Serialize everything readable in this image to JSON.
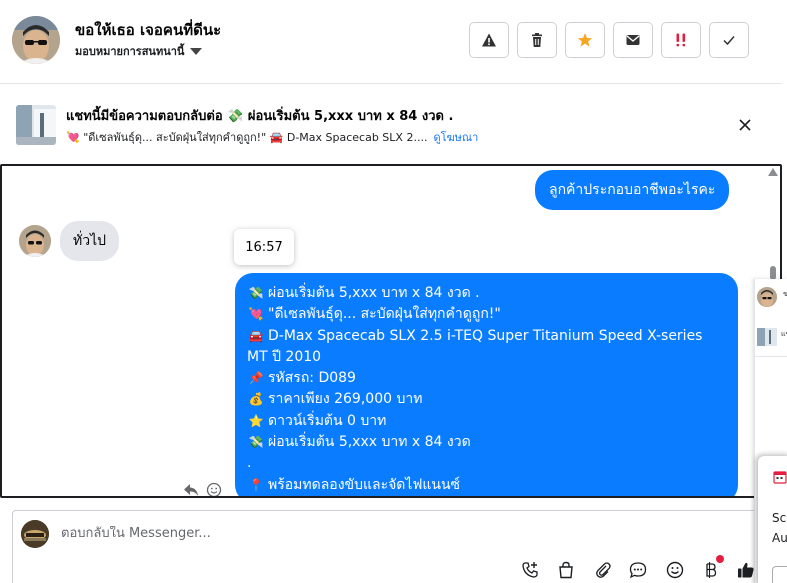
{
  "header": {
    "contact_name": "ขอให้เธอ เจอคนที่ดีนะ",
    "assign_label": "มอบหมายการสนทนานี้",
    "actions": [
      {
        "icon": "warning-icon"
      },
      {
        "icon": "trash-icon"
      },
      {
        "icon": "star-icon",
        "color": "#f5a623"
      },
      {
        "icon": "mail-icon"
      },
      {
        "icon": "priority-icon",
        "color": "#e41e3f"
      },
      {
        "icon": "check-icon"
      }
    ]
  },
  "banner": {
    "title": "แชทนี้มีข้อความตอบกลับต่อ 💸 ผ่อนเริ่มต้น 5,xxx บาท x 84 งวด .",
    "subtitle": "💘 \"ดีเซลพันธุ์ดุ... สะบัดฝุ่นใส่ทุกคำดูถูก!\" 🚘 D-Max Spacecab SLX 2....",
    "link": "ดูโฆษณา"
  },
  "messages": {
    "outgoing_1": "ลูกค้าประกอบอาชีพอะไรคะ",
    "incoming_1": "ทั่วไป",
    "timestamp": "16:57",
    "outgoing_2_lines": [
      {
        "emoji": "💸",
        "text": "ผ่อนเริ่มต้น 5,xxx บาท x 84 งวด ."
      },
      {
        "emoji": "💘",
        "text": "\"ดีเซลพันธุ์ดุ... สะบัดฝุ่นใส่ทุกคำดูถูก!\""
      },
      {
        "emoji": "🚘",
        "text": "D-Max Spacecab SLX 2.5 i-TEQ Super Titanium Speed X-series"
      },
      {
        "emoji": "",
        "text": "MT ปี 2010"
      },
      {
        "emoji": "📌",
        "text": "รหัสรถ: D089"
      },
      {
        "emoji": "💰",
        "text": "ราคาเพียง 269,000 บาท"
      },
      {
        "emoji": "⭐",
        "text": "ดาวน์เริ่มต้น 0 บาท"
      },
      {
        "emoji": "💸",
        "text": "ผ่อนเริ่มต้น 5,xxx บาท x 84 งวด"
      },
      {
        "emoji": "",
        "text": "."
      },
      {
        "emoji": "📍",
        "text": "พร้อมทดลองขับและจัดไฟแนนซ์"
      }
    ]
  },
  "composer": {
    "placeholder": "ตอบกลับใน Messenger...",
    "tools": [
      "add-contact-icon",
      "shopping-bag-icon",
      "paperclip-icon",
      "chat-bubble-icon",
      "emoji-icon",
      "currency-icon",
      "thumbs-up-icon"
    ]
  },
  "side_panel": {
    "row1_text": "ข",
    "row2_text": "แช",
    "popup_line1": "Sc",
    "popup_line2": "Au"
  },
  "colors": {
    "accent": "#0a7cff",
    "link": "#1877f2",
    "star": "#f5a623",
    "alert": "#e41e3f"
  }
}
